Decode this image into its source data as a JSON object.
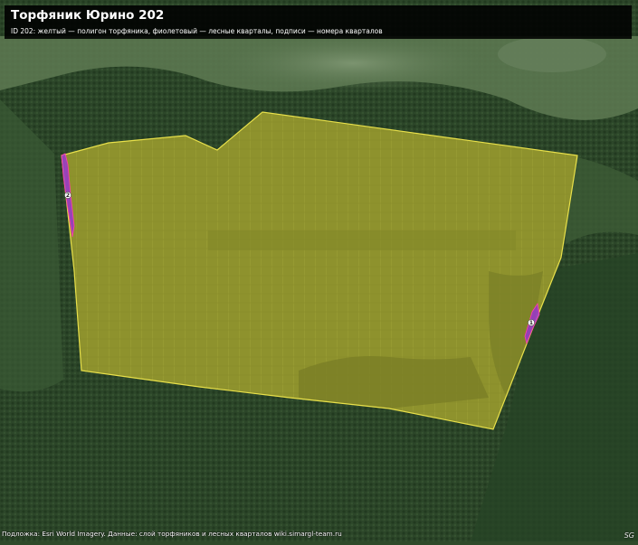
{
  "title": "Торфяник Юрино 202",
  "subtitle": "ID 202: желтый — полигон торфяника, фиолетовый — лесные кварталы, подписи — номера кварталов",
  "attribution": "Подложка: Esri World Imagery. Данные: слой торфяников и лесных кварталов wiki.simargl-team.ru",
  "badge": "SG",
  "quarters": [
    {
      "number": "2"
    },
    {
      "number": "1"
    }
  ],
  "colors": {
    "peat_polygon_fill": "#b9b21f",
    "peat_polygon_stroke": "#e8e04a",
    "forest_quarter": "#9b30d9",
    "quarter_edge": "#ff3fa8",
    "imagery_forest": "#2d4a2b",
    "imagery_meadow": "#6f8a55"
  },
  "icons": [
    "quarter-marker-icon"
  ]
}
